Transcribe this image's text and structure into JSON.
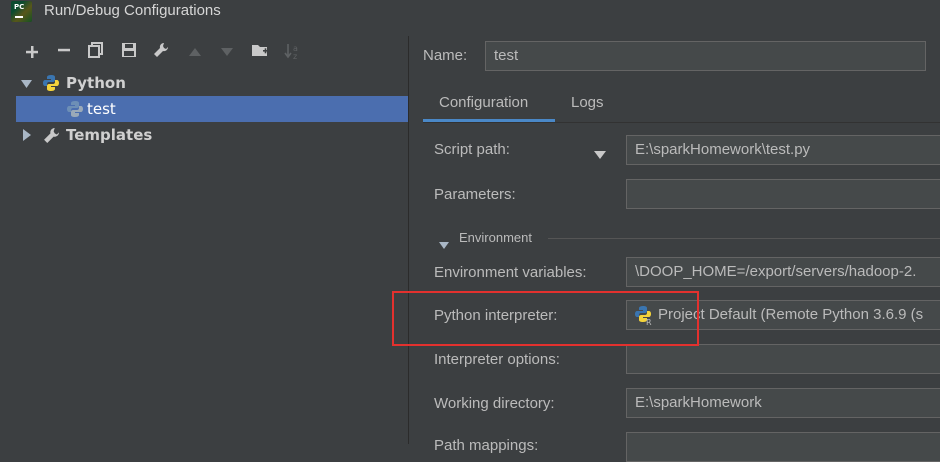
{
  "window": {
    "title": "Run/Debug Configurations"
  },
  "toolbar": {
    "buttons": [
      {
        "name": "add",
        "glyph": "+"
      },
      {
        "name": "remove",
        "glyph": "−"
      },
      {
        "name": "copy",
        "glyph": "⧉"
      },
      {
        "name": "save",
        "glyph": "▣"
      },
      {
        "name": "edit-defaults",
        "glyph": "🔧"
      },
      {
        "name": "move-up",
        "glyph": "▲"
      },
      {
        "name": "move-down",
        "glyph": "▼"
      },
      {
        "name": "new-folder",
        "glyph": "📁"
      },
      {
        "name": "sort",
        "glyph": "↓a"
      }
    ]
  },
  "tree": {
    "python_label": "Python",
    "test_label": "test",
    "templates_label": "Templates"
  },
  "form": {
    "name_label": "Name:",
    "name_value": "test",
    "tabs": [
      "Configuration",
      "Logs"
    ],
    "script_path_label": "Script path:",
    "script_path_value": "E:\\sparkHomework\\test.py",
    "parameters_label": "Parameters:",
    "parameters_value": "",
    "environment_label": "Environment",
    "env_vars_label": "Environment variables:",
    "env_vars_value": "\\DOOP_HOME=/export/servers/hadoop-2.",
    "interpreter_label": "Python interpreter:",
    "interpreter_value": "Project Default (Remote Python 3.6.9 (s",
    "interpreter_options_label": "Interpreter options:",
    "interpreter_options_value": "",
    "working_dir_label": "Working directory:",
    "working_dir_value": "E:\\sparkHomework",
    "path_mappings_label": "Path mappings:"
  },
  "colors": {
    "background": "#3c3f41",
    "selection": "#4b6eaf",
    "highlight_box": "#e3312e",
    "tab_underline": "#4a88c7"
  }
}
